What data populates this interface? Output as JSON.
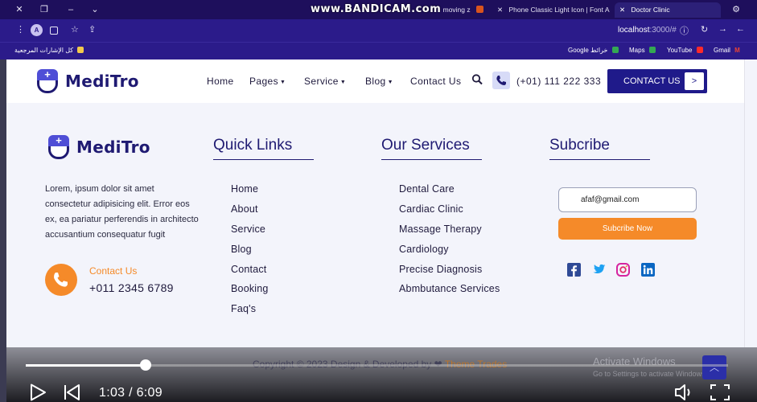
{
  "browser": {
    "watermark": "www.BANDICAM.com",
    "tabs": [
      {
        "label": "moving z",
        "active": false
      },
      {
        "label": "Phone Classic Light Icon | Font A",
        "active": false
      },
      {
        "label": "Doctor Clinic",
        "active": true
      }
    ],
    "url": "localhost",
    "url_port": ":3000/#",
    "bookmarks": {
      "all": "كل الإشارات المرجعية",
      "google": "Google خرائط",
      "maps": "Maps",
      "youtube": "YouTube",
      "gmail": "Gmail"
    },
    "avatar_letter": "A",
    "colors": {
      "chrome": "#2b1b8a",
      "tabbar": "#1e0f5c"
    }
  },
  "site": {
    "brand": "MediTro",
    "nav": {
      "home": "Home",
      "pages": "Pages",
      "service": "Service",
      "blog": "Blog",
      "contact": "Contact Us",
      "phone": "(+01) 111 222 333",
      "cta": "CONTACT US",
      "cta_arrow": ">"
    },
    "footer": {
      "brand": "MediTro",
      "about": "Lorem, ipsum dolor sit amet consectetur adipisicing elit. Error eos ex, ea pariatur perferendis in architecto accusantium consequatur fugit",
      "contact_label": "Contact Us",
      "contact_phone": "+011 2345 6789",
      "quick_links_title": "Quick Links",
      "quick_links": [
        "Home",
        "About",
        "Service",
        "Blog",
        "Contact",
        "Booking",
        "Faq's"
      ],
      "services_title": "Our Services",
      "services": [
        "Dental Care",
        "Cardiac Clinic",
        "Massage Therapy",
        "Cardiology",
        "Precise Diagnosis",
        "Abmbutance Services"
      ],
      "subscribe_title": "Subcribe",
      "email_value": "afaf@gmail.com",
      "subscribe_btn": "Subcribe Now",
      "social_icons": [
        "facebook-icon",
        "twitter-icon",
        "instagram-icon",
        "linkedin-icon"
      ],
      "copyright": "Copyright © 2023 Design & Developed by",
      "copyright_brand": "Theme Trades"
    },
    "colors": {
      "primary": "#1f1a72",
      "accent": "#f58a29"
    }
  },
  "overlay": {
    "activate_title": "Activate Windows",
    "activate_sub": "Go to Settings to activate Windows."
  },
  "player": {
    "time": "1:03 / 6:09",
    "progress": 0.171
  }
}
